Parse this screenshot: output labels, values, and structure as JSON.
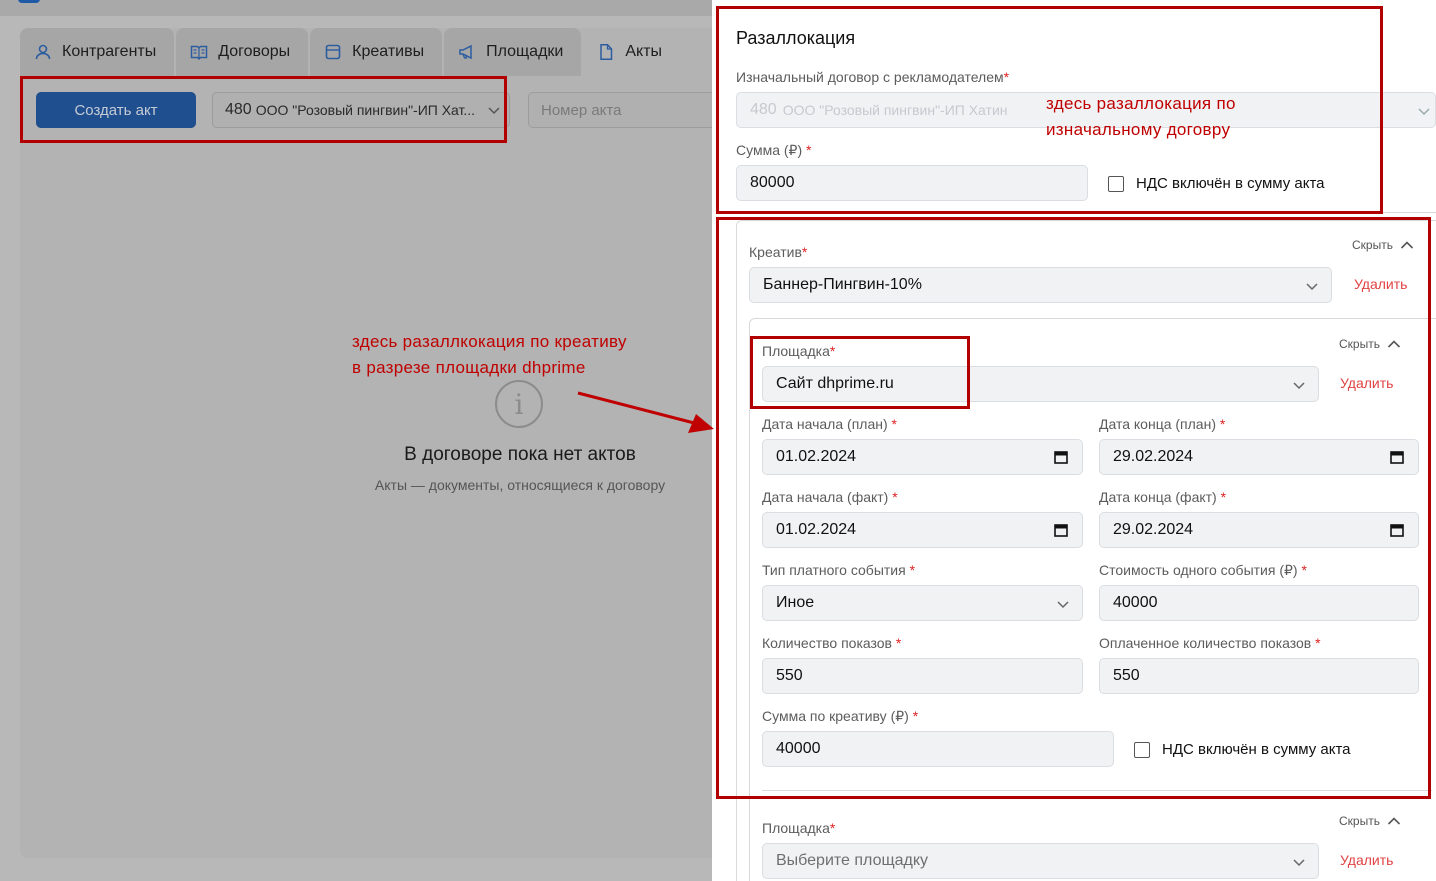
{
  "tabs": [
    {
      "label": "Контрагенты",
      "icon": "user-icon"
    },
    {
      "label": "Договоры",
      "icon": "book-icon"
    },
    {
      "label": "Креативы",
      "icon": "creative-icon"
    },
    {
      "label": "Площадки",
      "icon": "megaphone-icon"
    },
    {
      "label": "Акты",
      "icon": "document-icon"
    }
  ],
  "toolbar": {
    "create_label": "Создать акт",
    "contract_num": "480",
    "contract_name": "ООО \"Розовый пингвин\"-ИП Хат...",
    "act_number_placeholder": "Номер акта"
  },
  "empty": {
    "title": "В договоре пока нет актов",
    "subtitle": "Акты — документы, относящиеся к договору"
  },
  "notes": {
    "left_line1": "здесь разаллкокация по креативу",
    "left_line2": "в разрезе площадки dhprime",
    "right_line1": "здесь разаллокация по",
    "right_line2": "изначальному договру"
  },
  "panel": {
    "title": "Разаллокация",
    "contract_label": "Изначальный договор с рекламодателем",
    "contract_num": "480",
    "contract_name": "ООО \"Розовый пингвин\"-ИП Хатин",
    "sum_label": "Сумма (₽)",
    "sum_value": "80000",
    "vat_label": "НДС включён в сумму акта",
    "creative": {
      "label": "Креатив",
      "value": "Баннер-Пингвин-10%",
      "hide": "Скрыть",
      "delete": "Удалить"
    },
    "platform": {
      "label": "Площадка",
      "value": "Сайт dhprime.ru",
      "hide": "Скрыть",
      "delete": "Удалить",
      "start_plan_label": "Дата начала (план)",
      "start_plan": "01.02.2024",
      "end_plan_label": "Дата конца (план)",
      "end_plan": "29.02.2024",
      "start_fact_label": "Дата начала (факт)",
      "start_fact": "01.02.2024",
      "end_fact_label": "Дата конца (факт)",
      "end_fact": "29.02.2024",
      "event_type_label": "Тип платного события",
      "event_type": "Иное",
      "event_cost_label": "Стоимость одного события (₽)",
      "event_cost": "40000",
      "impressions_label": "Количество показов",
      "impressions": "550",
      "paid_impressions_label": "Оплаченное количество показов",
      "paid_impressions": "550",
      "creative_sum_label": "Сумма по креативу (₽)",
      "creative_sum": "40000",
      "vat_label": "НДС включён в сумму акта"
    },
    "platform2": {
      "label": "Площадка",
      "placeholder": "Выберите площадку",
      "hide": "Скрыть",
      "delete": "Удалить"
    }
  },
  "colors": {
    "annotation": "#c00000",
    "primary_button": "#1f4f8f",
    "delete_link": "#e04343",
    "required": "#d22222"
  }
}
